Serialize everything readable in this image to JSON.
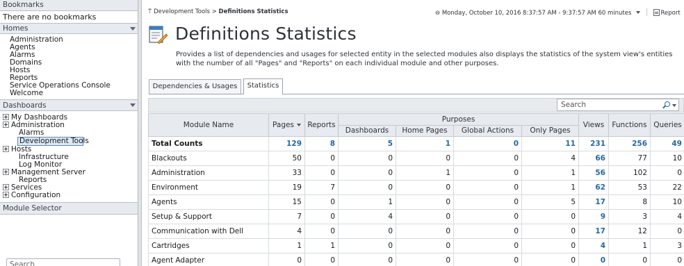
{
  "sidebar": {
    "bookmarks_header": "Bookmarks",
    "no_bookmarks": "There are no bookmarks",
    "homes_header": "Homes",
    "homes_items": [
      "Administration",
      "Agents",
      "Alarms",
      "Domains",
      "Hosts",
      "Reports",
      "Service Operations Console",
      "Welcome"
    ],
    "dashboards_header": "Dashboards",
    "tree": [
      {
        "label": "My Dashboards",
        "expandable": true
      },
      {
        "label": "Administration",
        "expandable": true
      },
      {
        "label": "Alarms",
        "expandable": false
      },
      {
        "label": "Development Tools",
        "expandable": false,
        "selected": true
      },
      {
        "label": "Hosts",
        "expandable": true
      },
      {
        "label": "Infrastructure",
        "expandable": false
      },
      {
        "label": "Log Monitor",
        "expandable": false
      },
      {
        "label": "Management Server",
        "expandable": true
      },
      {
        "label": "Reports",
        "expandable": false
      },
      {
        "label": "Services",
        "expandable": true
      },
      {
        "label": "Configuration",
        "expandable": true
      }
    ],
    "module_selector_header": "Module Selector",
    "search_placeholder": "Search"
  },
  "main": {
    "breadcrumb_parent": "Development Tools",
    "breadcrumb_sep": ">",
    "breadcrumb_current": "Definitions Statistics",
    "time_range": "Monday, October 10, 2016 8:37:57 AM - 9:37:57 AM 60 minutes",
    "report_label": "Report",
    "page_title": "Definitions Statistics",
    "description": "Provides a list of dependencies and usages for selected entity in the selected modules also displays the statistics of the system view's entities with the number of all \"Pages\" and \"Reports\" on each individual module and other purposes.",
    "tabs": [
      {
        "label": "Dependencies & Usages",
        "active": false
      },
      {
        "label": "Statistics",
        "active": true
      }
    ],
    "search_placeholder": "Search"
  },
  "table": {
    "headers": {
      "module_name": "Module Name",
      "pages": "Pages",
      "reports": "Reports",
      "purposes": "Purposes",
      "dashboards": "Dashboards",
      "home_pages": "Home Pages",
      "global_actions": "Global Actions",
      "only_pages": "Only Pages",
      "views": "Views",
      "functions": "Functions",
      "queries": "Queries"
    },
    "rows": [
      {
        "name": "Total Counts",
        "pages": "129",
        "reports": "8",
        "dashboards": "5",
        "home_pages": "1",
        "global_actions": "0",
        "only_pages": "11",
        "views": "231",
        "functions": "256",
        "queries": "49"
      },
      {
        "name": "Blackouts",
        "pages": "50",
        "reports": "0",
        "dashboards": "0",
        "home_pages": "0",
        "global_actions": "0",
        "only_pages": "4",
        "views": "66",
        "functions": "77",
        "queries": "10"
      },
      {
        "name": "Administration",
        "pages": "33",
        "reports": "0",
        "dashboards": "0",
        "home_pages": "1",
        "global_actions": "0",
        "only_pages": "1",
        "views": "56",
        "functions": "102",
        "queries": "0"
      },
      {
        "name": "Environment",
        "pages": "19",
        "reports": "7",
        "dashboards": "0",
        "home_pages": "0",
        "global_actions": "0",
        "only_pages": "1",
        "views": "62",
        "functions": "53",
        "queries": "22"
      },
      {
        "name": "Agents",
        "pages": "15",
        "reports": "0",
        "dashboards": "1",
        "home_pages": "0",
        "global_actions": "0",
        "only_pages": "5",
        "views": "17",
        "functions": "8",
        "queries": "10"
      },
      {
        "name": "Setup & Support",
        "pages": "7",
        "reports": "0",
        "dashboards": "4",
        "home_pages": "0",
        "global_actions": "0",
        "only_pages": "0",
        "views": "9",
        "functions": "3",
        "queries": "4"
      },
      {
        "name": "Communication with Dell",
        "pages": "4",
        "reports": "0",
        "dashboards": "0",
        "home_pages": "0",
        "global_actions": "0",
        "only_pages": "0",
        "views": "17",
        "functions": "12",
        "queries": "0"
      },
      {
        "name": "Cartridges",
        "pages": "1",
        "reports": "1",
        "dashboards": "0",
        "home_pages": "0",
        "global_actions": "0",
        "only_pages": "0",
        "views": "4",
        "functions": "1",
        "queries": "3"
      },
      {
        "name": "Agent Adapter",
        "pages": "0",
        "reports": "0",
        "dashboards": "0",
        "home_pages": "0",
        "global_actions": "0",
        "only_pages": "0",
        "views": "0",
        "functions": "0",
        "queries": "0"
      }
    ]
  },
  "colors": {
    "link": "#2466a8",
    "header_bg": "#e7eaee",
    "selection_border": "#5d86b8"
  }
}
